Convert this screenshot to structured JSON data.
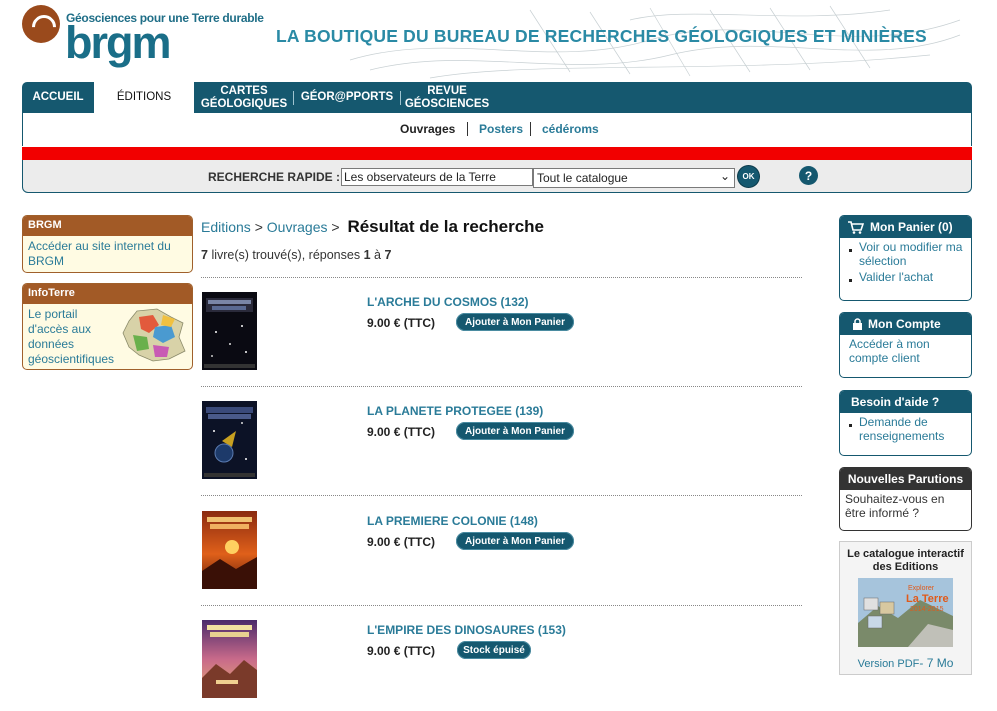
{
  "header": {
    "tagline": "Géosciences pour une Terre durable",
    "logo_word": "brgm",
    "site_title": "LA BOUTIQUE DU BUREAU DE RECHERCHES GÉOLOGIQUES ET MINIÈRES"
  },
  "nav": {
    "items": [
      "ACCUEIL",
      "ÉDITIONS",
      "CARTES GÉOLOGIQUES",
      "GÉOR@PPORTS",
      "REVUE GÉOSCIENCES"
    ],
    "active": "ÉDITIONS"
  },
  "subnav": {
    "items": [
      "Ouvrages",
      "Posters",
      "cédéroms"
    ],
    "active": "Ouvrages"
  },
  "search": {
    "label": "RECHERCHE RAPIDE :",
    "query": "Les observateurs de la Terre",
    "scope": "Tout le catalogue",
    "ok_label": "OK",
    "help_label": "?"
  },
  "left": {
    "brgm": {
      "title": "BRGM",
      "text": "Accéder au site internet du BRGM"
    },
    "infoterre": {
      "title": "InfoTerre",
      "text": "Le portail d'accès aux données géoscientifiques du BRGM"
    }
  },
  "breadcrumb": {
    "editions": "Editions",
    "ouvrages": "Ouvrages",
    "separator": ">",
    "current": "Résultat de la recherche"
  },
  "results": {
    "count": "7",
    "found_text": "livre(s) trouvé(s), réponses",
    "from": "1",
    "to_word": "à",
    "to": "7"
  },
  "products": [
    {
      "title": "L'ARCHE DU COSMOS (132)",
      "price": "9.00 € (TTC)",
      "button": "Ajouter à Mon Panier",
      "in_stock": true
    },
    {
      "title": "LA PLANETE PROTEGEE (139)",
      "price": "9.00 € (TTC)",
      "button": "Ajouter à Mon Panier",
      "in_stock": true
    },
    {
      "title": "LA PREMIERE COLONIE (148)",
      "price": "9.00 € (TTC)",
      "button": "Ajouter à Mon Panier",
      "in_stock": true
    },
    {
      "title": "L'EMPIRE DES DINOSAURES (153)",
      "price": "9.00 € (TTC)",
      "button": "Stock épuisé",
      "in_stock": false
    }
  ],
  "right": {
    "cart": {
      "title": "Mon Panier (0)",
      "links": [
        "Voir ou modifier ma sélection",
        "Valider l'achat"
      ]
    },
    "account": {
      "title": "Mon Compte",
      "text": "Accéder à mon compte client"
    },
    "help": {
      "title": "Besoin d'aide ?",
      "links": [
        "Demande de renseignements"
      ]
    },
    "news": {
      "title": "Nouvelles Parutions",
      "text": "Souhaitez-vous en être informé ?"
    },
    "catalog": {
      "title": "Le catalogue interactif des Editions",
      "cover_top": "Explorer",
      "cover_mid": "La Terre",
      "cover_years": "2014-2015",
      "link": "Version PDF",
      "size": "- 7 Mo"
    }
  },
  "colors": {
    "nav_blue": "#15586f",
    "link_blue": "#2a7b98",
    "brand_brown": "#a25a26",
    "alert_red": "#f20000"
  }
}
